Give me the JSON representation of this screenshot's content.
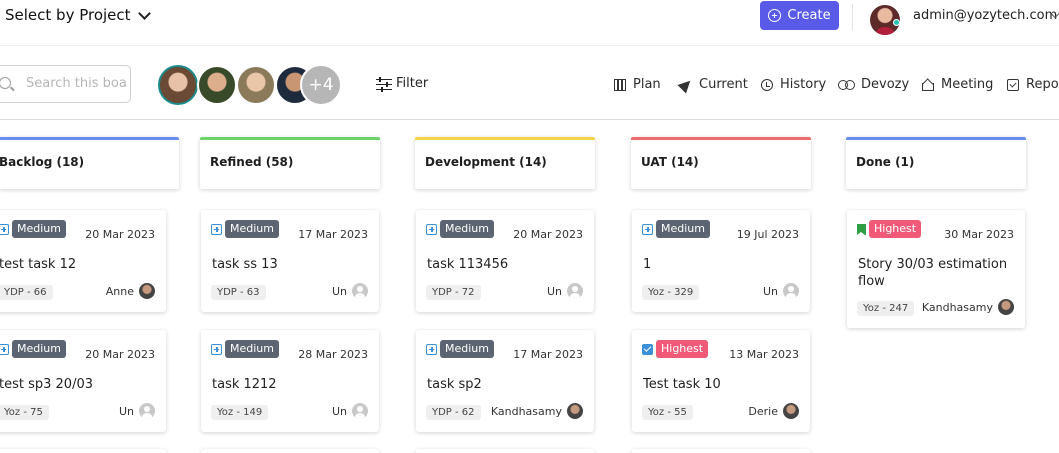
{
  "header": {
    "project_select": "Select by Project",
    "create_label": "Create",
    "user_email": "admin@yozytech.com"
  },
  "toolbar": {
    "search_placeholder": "Search this board",
    "more_members": "+4",
    "filter_label": "Filter",
    "nav": [
      "Plan",
      "Current",
      "History",
      "Devozy",
      "Meeting",
      "Report"
    ]
  },
  "colors": {
    "accent": "#5a5ae8",
    "backlog": "#6b8cf0",
    "refined": "#6ad36a",
    "development": "#f4d54a",
    "uat": "#ef6a6a",
    "done": "#6b8cf0",
    "medium": "#5b6470",
    "highest": "#f05a78"
  },
  "columns": [
    {
      "header": "Backlog (18)",
      "cards": [
        {
          "type": "subtask-icon",
          "priority": "Medium",
          "date": "20 Mar 2023",
          "title": "test task 12",
          "key": "YDP  - 66",
          "assignee": "Anne",
          "avatar": "photo"
        },
        {
          "type": "subtask-icon",
          "priority": "Medium",
          "date": "20 Mar 2023",
          "title": "test sp3 20/03",
          "key": "Yoz  - 75",
          "assignee": "Un",
          "avatar": "generic"
        }
      ]
    },
    {
      "header": "Refined (58)",
      "cards": [
        {
          "type": "subtask-icon",
          "priority": "Medium",
          "date": "17 Mar 2023",
          "title": "task ss 13",
          "key": "YDP  - 63",
          "assignee": "Un",
          "avatar": "generic"
        },
        {
          "type": "subtask-icon",
          "priority": "Medium",
          "date": "28 Mar 2023",
          "title": "task 1212",
          "key": "Yoz  - 149",
          "assignee": "Un",
          "avatar": "generic"
        }
      ]
    },
    {
      "header": "Development (14)",
      "cards": [
        {
          "type": "subtask-icon",
          "priority": "Medium",
          "date": "20 Mar 2023",
          "title": "task 113456",
          "key": "YDP  - 72",
          "assignee": "Un",
          "avatar": "generic"
        },
        {
          "type": "subtask-icon",
          "priority": "Medium",
          "date": "17 Mar 2023",
          "title": "task sp2",
          "key": "YDP  - 62",
          "assignee": "Kandhasamy",
          "avatar": "photo"
        }
      ]
    },
    {
      "header": "UAT (14)",
      "cards": [
        {
          "type": "subtask-icon",
          "priority": "Medium",
          "date": "19 Jul 2023",
          "title": "1",
          "key": "Yoz  - 329",
          "assignee": "Un",
          "avatar": "generic"
        },
        {
          "type": "task-icon",
          "priority": "Highest",
          "date": "13 Mar 2023",
          "title": "Test task 10",
          "key": "Yoz  - 55",
          "assignee": "Derie",
          "avatar": "photo"
        }
      ]
    },
    {
      "header": "Done (1)",
      "cards": [
        {
          "type": "story-icon",
          "priority": "Highest",
          "date": "30 Mar 2023",
          "title": "Story 30/03 estimation flow",
          "key": "Yoz  - 247",
          "assignee": "Kandhasamy",
          "avatar": "photo"
        }
      ]
    }
  ]
}
